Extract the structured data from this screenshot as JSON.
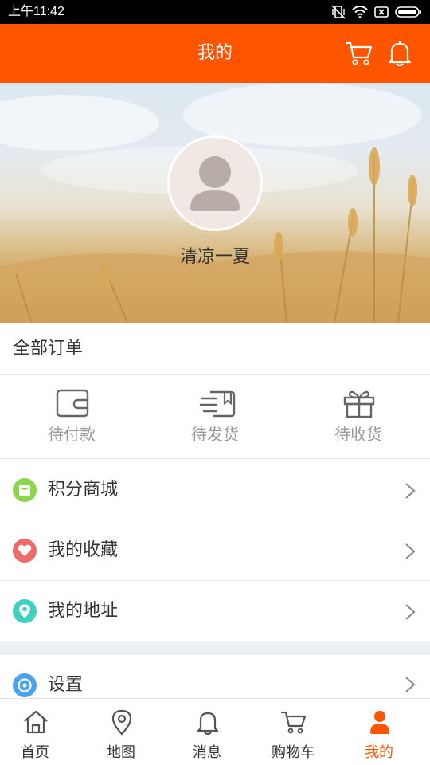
{
  "status_bar": {
    "time": "上午11:42",
    "icons": [
      "vibrate-off-icon",
      "wifi-icon",
      "sim-icon",
      "battery-icon"
    ]
  },
  "header": {
    "title": "我的",
    "icons": [
      "cart-icon",
      "bell-icon"
    ]
  },
  "profile": {
    "username": "清凉一夏",
    "avatar_icon": "default-user-avatar"
  },
  "orders": {
    "title": "全部订单",
    "items": [
      {
        "label": "待付款",
        "icon": "wallet-icon"
      },
      {
        "label": "待发货",
        "icon": "shipping-doc-icon"
      },
      {
        "label": "待收货",
        "icon": "gift-icon"
      }
    ]
  },
  "menu": [
    {
      "label": "积分商城",
      "icon": "mall-bag-icon",
      "color": "#8cd64e"
    },
    {
      "label": "我的收藏",
      "icon": "heart-icon",
      "color": "#f06a6a"
    },
    {
      "label": "我的地址",
      "icon": "location-pin-icon",
      "color": "#3fd0c0"
    },
    {
      "label": "设置",
      "icon": "settings-icon",
      "color": "#4aa3f0"
    }
  ],
  "bottom_nav": [
    {
      "label": "首页",
      "icon": "home-icon",
      "active": false
    },
    {
      "label": "地图",
      "icon": "map-pin-icon",
      "active": false
    },
    {
      "label": "消息",
      "icon": "bell-icon",
      "active": false
    },
    {
      "label": "购物车",
      "icon": "cart-icon",
      "active": false
    },
    {
      "label": "我的",
      "icon": "user-icon",
      "active": true
    }
  ],
  "colors": {
    "brand": "#ff5500",
    "text": "#333333",
    "muted": "#999999",
    "divider": "#e6e6e6"
  }
}
